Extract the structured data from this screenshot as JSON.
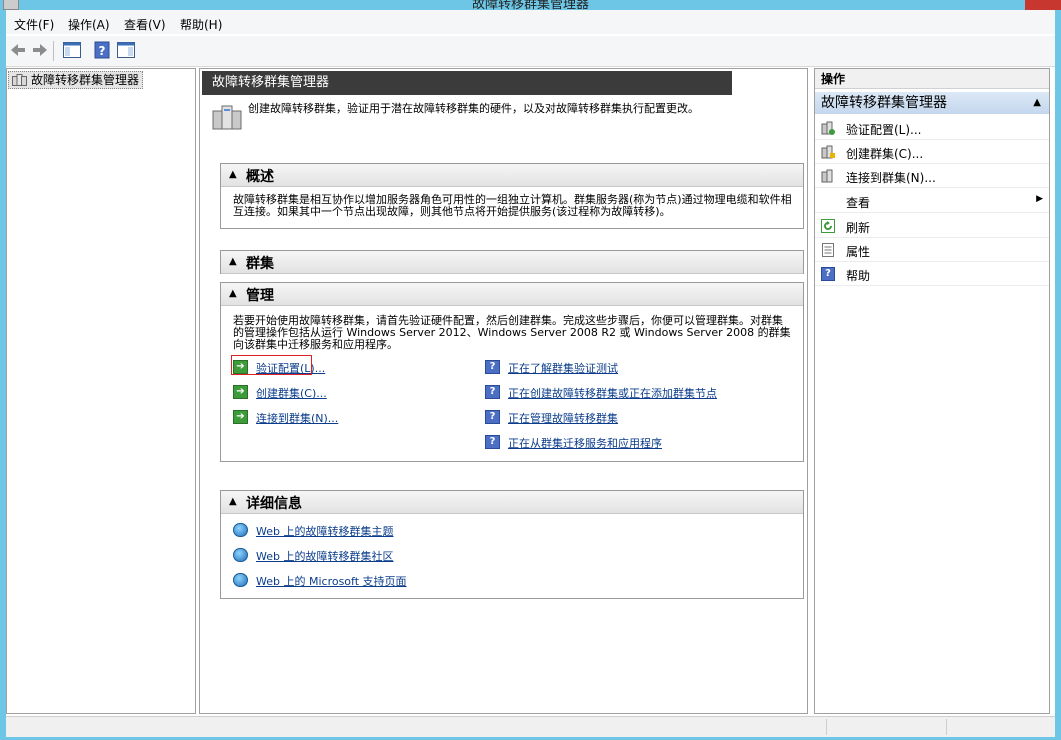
{
  "window": {
    "title": "故障转移群集管理器"
  },
  "menu": [
    {
      "label": "文件(F)"
    },
    {
      "label": "操作(A)"
    },
    {
      "label": "查看(V)"
    },
    {
      "label": "帮助(H)"
    }
  ],
  "tree": {
    "root_label": "故障转移群集管理器"
  },
  "center": {
    "header": "故障转移群集管理器",
    "intro": "创建故障转移群集，验证用于潜在故障转移群集的硬件，以及对故障转移群集执行配置更改。",
    "overview": {
      "title": "概述",
      "text": "故障转移群集是相互协作以增加服务器角色可用性的一组独立计算机。群集服务器(称为节点)通过物理电缆和软件相互连接。如果其中一个节点出现故障，则其他节点将开始提供服务(该过程称为故障转移)。"
    },
    "clusters": {
      "title": "群集"
    },
    "management": {
      "title": "管理",
      "text": "若要开始使用故障转移群集，请首先验证硬件配置，然后创建群集。完成这些步骤后，你便可以管理群集。对群集的管理操作包括从运行 Windows Server 2012、Windows Server 2008 R2 或 Windows Server 2008 的群集向该群集中迁移服务和应用程序。",
      "actions": [
        {
          "label": "验证配置(L)..."
        },
        {
          "label": "创建群集(C)..."
        },
        {
          "label": "连接到群集(N)..."
        }
      ],
      "help_links": [
        {
          "label": "正在了解群集验证测试"
        },
        {
          "label": "正在创建故障转移群集或正在添加群集节点"
        },
        {
          "label": "正在管理故障转移群集"
        },
        {
          "label": "正在从群集迁移服务和应用程序"
        }
      ]
    },
    "details": {
      "title": "详细信息",
      "links": [
        {
          "label": "Web 上的故障转移群集主题"
        },
        {
          "label": "Web 上的故障转移群集社区"
        },
        {
          "label": "Web 上的 Microsoft 支持页面"
        }
      ]
    }
  },
  "actions_pane": {
    "header": "操作",
    "subheader": "故障转移群集管理器",
    "items": [
      {
        "label": "验证配置(L)...",
        "icon": "cluster-validate-icon"
      },
      {
        "label": "创建群集(C)...",
        "icon": "cluster-create-icon"
      },
      {
        "label": "连接到群集(N)...",
        "icon": "cluster-connect-icon"
      },
      {
        "label": "查看",
        "icon": ""
      },
      {
        "label": "刷新",
        "icon": "refresh-icon"
      },
      {
        "label": "属性",
        "icon": "properties-icon"
      },
      {
        "label": "帮助",
        "icon": "help-icon"
      }
    ]
  },
  "colors": {
    "accent": "#6ec6e6",
    "link": "#0b3d8c",
    "header_dark": "#3b3b3b",
    "highlight": "#e02020"
  }
}
